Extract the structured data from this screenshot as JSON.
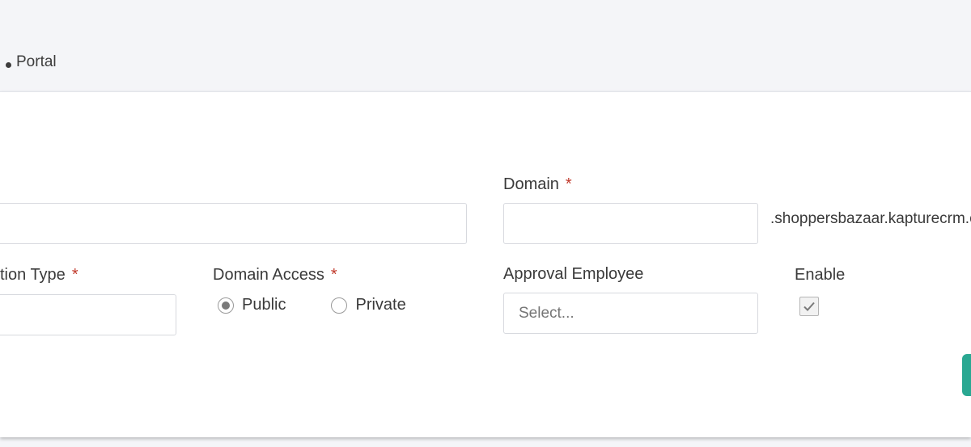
{
  "breadcrumb": {
    "current": "Portal"
  },
  "form": {
    "name_field": {
      "value": ""
    },
    "domain": {
      "label": "Domain",
      "required_mark": "*",
      "value": "",
      "suffix": ".shoppersbazaar.kapturecrm.com"
    },
    "type_field": {
      "label": "tion Type",
      "required_mark": "*",
      "value": ""
    },
    "domain_access": {
      "label": "Domain Access",
      "required_mark": "*",
      "options": [
        "Public",
        "Private"
      ],
      "selected": "Public"
    },
    "approval_employee": {
      "label": "Approval Employee",
      "placeholder": "Select..."
    },
    "enable": {
      "label": "Enable",
      "checked": true
    }
  },
  "colors": {
    "accent": "#2aa892",
    "required": "#c0392b"
  }
}
